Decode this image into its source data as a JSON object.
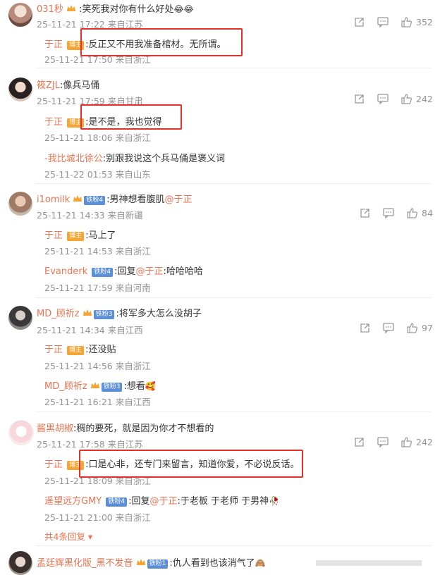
{
  "comments": [
    {
      "user": "031秒",
      "text": ":笑死我对你有什么好处",
      "emoji": "😂😂",
      "time": "25-11-21 17:22 来自江苏",
      "likes": "352",
      "replies": [
        {
          "user": "于正",
          "badge": "博主",
          "text": ":反正又不用我准备棺材。无所谓。",
          "time": "25-11-21 17:50 来自浙江"
        }
      ]
    },
    {
      "user": "筱ZJL",
      "text": ":像兵马俑",
      "time": "25-11-21 17:59 来自甘肃",
      "likes": "242",
      "replies": [
        {
          "user": "于正",
          "badge": "博主",
          "text": ":是不是，我也觉得",
          "time": "25-11-21 18:06 来自浙江"
        },
        {
          "user": "-我比城北徐公",
          "text": ":别跟我说这个兵马俑是褒义词",
          "time": "25-11-22 01:53 来自山东"
        }
      ]
    },
    {
      "user": "i1omilk",
      "fan_badge": "铁粉4",
      "text": ":男神想看腹肌",
      "mention": "@于正",
      "time": "25-11-21 14:33 来自新疆",
      "likes": "84",
      "replies": [
        {
          "user": "于正",
          "badge": "博主",
          "text": ":马上了",
          "time": "25-11-21 14:53 来自浙江"
        },
        {
          "user": "Evanderk",
          "fan_badge": "铁粉4",
          "text_pre": ":回复",
          "mention": "@于正",
          "text": ":哈哈哈哈",
          "time": "25-11-21 17:59 来自河南"
        }
      ]
    },
    {
      "user": "MD_顾祈z",
      "fan_badge": "铁粉3",
      "text": ":将军多大怎么没胡子",
      "time": "25-11-21 14:34 来自江西",
      "likes": "97",
      "replies": [
        {
          "user": "于正",
          "badge": "博主",
          "text": ":还没贴",
          "time": "25-11-21 14:56 来自浙江"
        },
        {
          "user": "MD_顾祈z",
          "fan_badge": "铁粉3",
          "text": ":想看",
          "emoji": "🥰",
          "time": "25-11-21 16:21 来自江西"
        }
      ]
    },
    {
      "user": "酱黑胡椒",
      "text": ":稠的要死，就是因为你才不想看的",
      "time": "25-11-21 17:58 来自江苏",
      "likes": "242",
      "replies": [
        {
          "user": "于正",
          "badge": "博主",
          "text": ":口是心非，还专门来留言，知道你爱，不必说反话。",
          "time": "25-11-21 18:09 来自浙江"
        },
        {
          "user": "遥望远方GMY",
          "fan_badge": "铁粉4",
          "text_pre": ":回复",
          "mention": "@于正",
          "text": ":于老板 于老师 于男神",
          "emoji": "🥀",
          "time": "25-11-21 21:00 来自浙江"
        }
      ],
      "more": "共4条回复 ▾"
    },
    {
      "user": "孟廷辉黑化版_黑不发音",
      "fan_badge": "铁粉1",
      "text": ":仇人看到也该消气了",
      "emoji": "🙈"
    }
  ],
  "icons": [
    "share-icon",
    "comment-icon",
    "like-icon",
    "crown-icon"
  ],
  "colors": {
    "name": "#eb7350",
    "meta": "#939393",
    "highlight_box": "#e0312a",
    "bozhu_badge": "#f4a534",
    "fan_badge": "#5b8fd8"
  }
}
